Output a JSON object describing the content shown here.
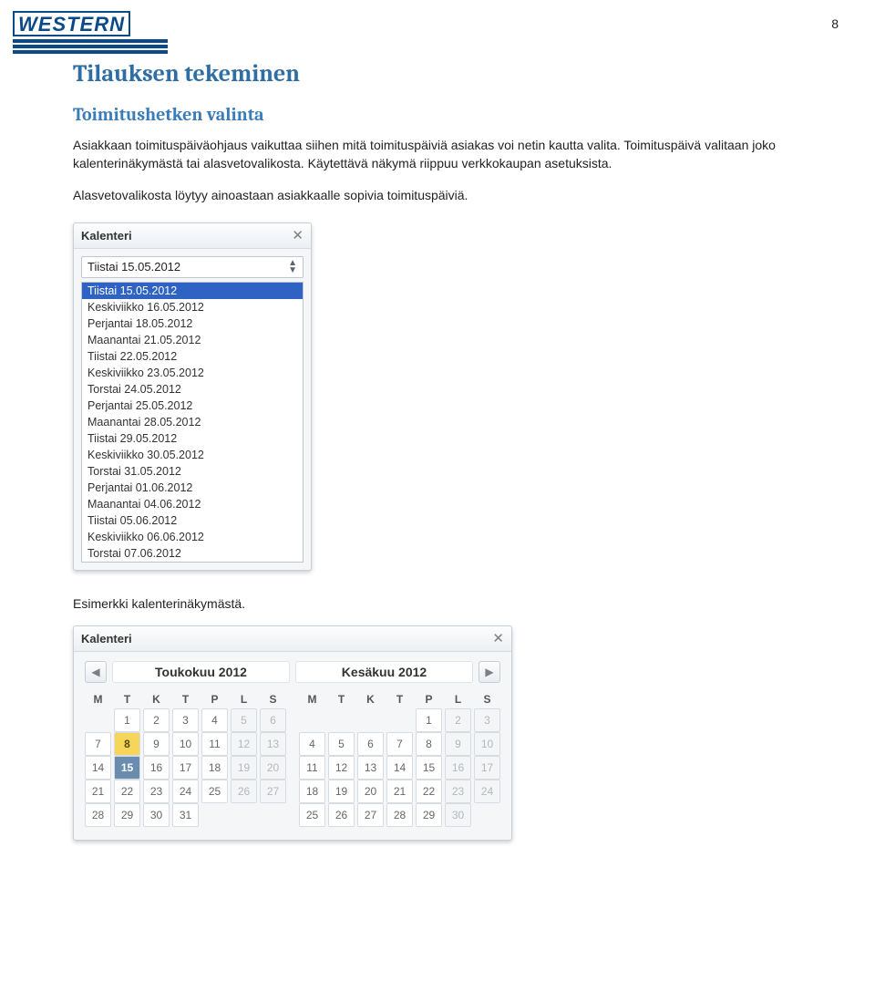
{
  "page_number": "8",
  "logo_text": "WESTERN",
  "h1": "Tilauksen tekeminen",
  "h2": "Toimitushetken valinta",
  "p1": "Asiakkaan toimituspäiväohjaus vaikuttaa siihen mitä toimituspäiviä asiakas voi netin kautta valita. Toimituspäivä valitaan joko kalenterinäkymästä tai alasvetovalikosta. Käytettävä näkymä riippuu verkkokaupan asetuksista.",
  "p2": "Alasvetovalikosta löytyy ainoastaan asiakkaalle sopivia toimituspäiviä.",
  "p3": "Esimerkki kalenterinäkymästä.",
  "dropdown": {
    "title": "Kalenteri",
    "selected_value": "Tiistai 15.05.2012",
    "options": [
      "Tiistai 15.05.2012",
      "Keskiviikko 16.05.2012",
      "Perjantai 18.05.2012",
      "Maanantai 21.05.2012",
      "Tiistai 22.05.2012",
      "Keskiviikko 23.05.2012",
      "Torstai 24.05.2012",
      "Perjantai 25.05.2012",
      "Maanantai 28.05.2012",
      "Tiistai 29.05.2012",
      "Keskiviikko 30.05.2012",
      "Torstai 31.05.2012",
      "Perjantai 01.06.2012",
      "Maanantai 04.06.2012",
      "Tiistai 05.06.2012",
      "Keskiviikko 06.06.2012",
      "Torstai 07.06.2012"
    ],
    "selected_index": 0
  },
  "calendar": {
    "title": "Kalenteri",
    "month_left": "Toukokuu 2012",
    "month_right": "Kesäkuu 2012",
    "dow": [
      "M",
      "T",
      "K",
      "T",
      "P",
      "L",
      "S"
    ],
    "may": [
      [
        "",
        "1",
        "2",
        "3",
        "4",
        "5",
        "6"
      ],
      [
        "7",
        "8",
        "9",
        "10",
        "11",
        "12",
        "13"
      ],
      [
        "14",
        "15",
        "16",
        "17",
        "18",
        "19",
        "20"
      ],
      [
        "21",
        "22",
        "23",
        "24",
        "25",
        "26",
        "27"
      ],
      [
        "28",
        "29",
        "30",
        "31",
        "",
        "",
        ""
      ]
    ],
    "june": [
      [
        "",
        "",
        "",
        "",
        "1",
        "2",
        "3"
      ],
      [
        "4",
        "5",
        "6",
        "7",
        "8",
        "9",
        "10"
      ],
      [
        "11",
        "12",
        "13",
        "14",
        "15",
        "16",
        "17"
      ],
      [
        "18",
        "19",
        "20",
        "21",
        "22",
        "23",
        "24"
      ],
      [
        "25",
        "26",
        "27",
        "28",
        "29",
        "30",
        ""
      ]
    ],
    "may_dim_cols_after": 5,
    "may_today": "8",
    "may_selected": "15"
  }
}
